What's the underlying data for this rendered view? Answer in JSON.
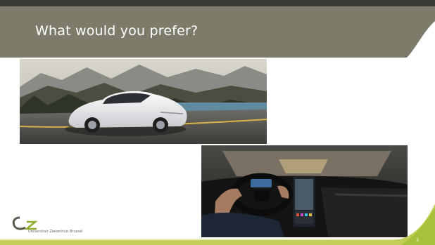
{
  "slide": {
    "title": "What would you prefer?",
    "page_number": "3"
  },
  "logo": {
    "org_name": "Universitair Ziekenhuis Brussel"
  },
  "images": {
    "car_photo": "white sports car on mountain road",
    "interior_photo": "driver at wheel with large touchscreen dashboard"
  },
  "colors": {
    "header": "#7d7b6a",
    "top_rule": "#3a3a36",
    "accent_green": "#a7c23a",
    "footer_band": "#c4cf5a"
  }
}
